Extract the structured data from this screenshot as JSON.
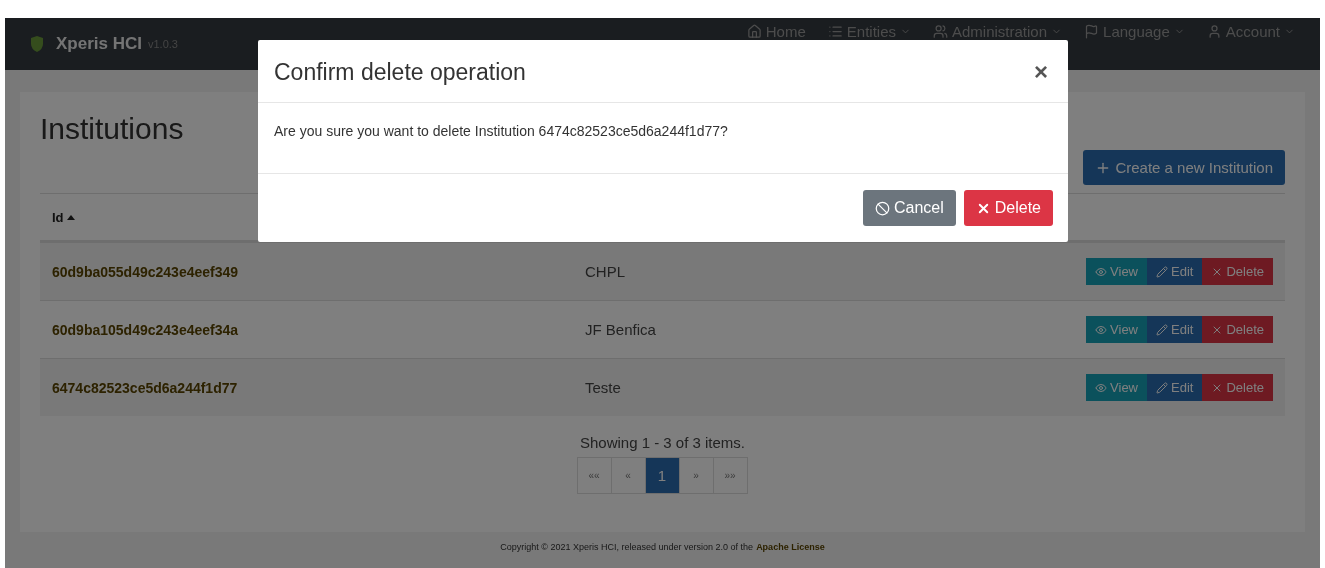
{
  "navbar": {
    "brand": "Xperis HCI",
    "version": "v1.0.3",
    "items": [
      {
        "label": "Home",
        "kind": "link"
      },
      {
        "label": "Entities",
        "kind": "dropdown"
      },
      {
        "label": "Administration",
        "kind": "dropdown"
      },
      {
        "label": "Language",
        "kind": "dropdown"
      },
      {
        "label": "Account",
        "kind": "dropdown"
      }
    ]
  },
  "page": {
    "title": "Institutions",
    "create_button": "Create a new Institution"
  },
  "table": {
    "columns": [
      {
        "label": "Id",
        "sorted": true
      }
    ],
    "rows": [
      {
        "id": "60d9ba055d49c243e4eef349",
        "name": "CHPL",
        "actions": [
          "View",
          "Edit",
          "Delete"
        ]
      },
      {
        "id": "60d9ba105d49c243e4eef34a",
        "name": "JF Benfica",
        "actions": [
          "View",
          "Edit",
          "Delete"
        ]
      },
      {
        "id": "6474c82523ce5d6a244f1d77",
        "name": "Teste",
        "actions": [
          "View",
          "Edit",
          "Delete"
        ]
      }
    ]
  },
  "pagination": {
    "summary": "Showing 1 - 3 of 3 items.",
    "pages": [
      {
        "label": "««",
        "selected": false
      },
      {
        "label": "«",
        "selected": false
      },
      {
        "label": "1",
        "selected": true
      },
      {
        "label": "»",
        "selected": false
      },
      {
        "label": "»»",
        "selected": false
      }
    ]
  },
  "footer": {
    "text": "Copyright © 2021 Xperis HCI, released under version 2.0 of the",
    "link": "Apache License"
  },
  "modal": {
    "title": "Confirm delete operation",
    "close": "×",
    "body": "Are you sure you want to delete Institution 6474c82523ce5d6a244f1d77?",
    "buttons": [
      {
        "label": "Cancel",
        "kind": "cancel"
      },
      {
        "label": "Delete",
        "kind": "danger"
      }
    ]
  }
}
